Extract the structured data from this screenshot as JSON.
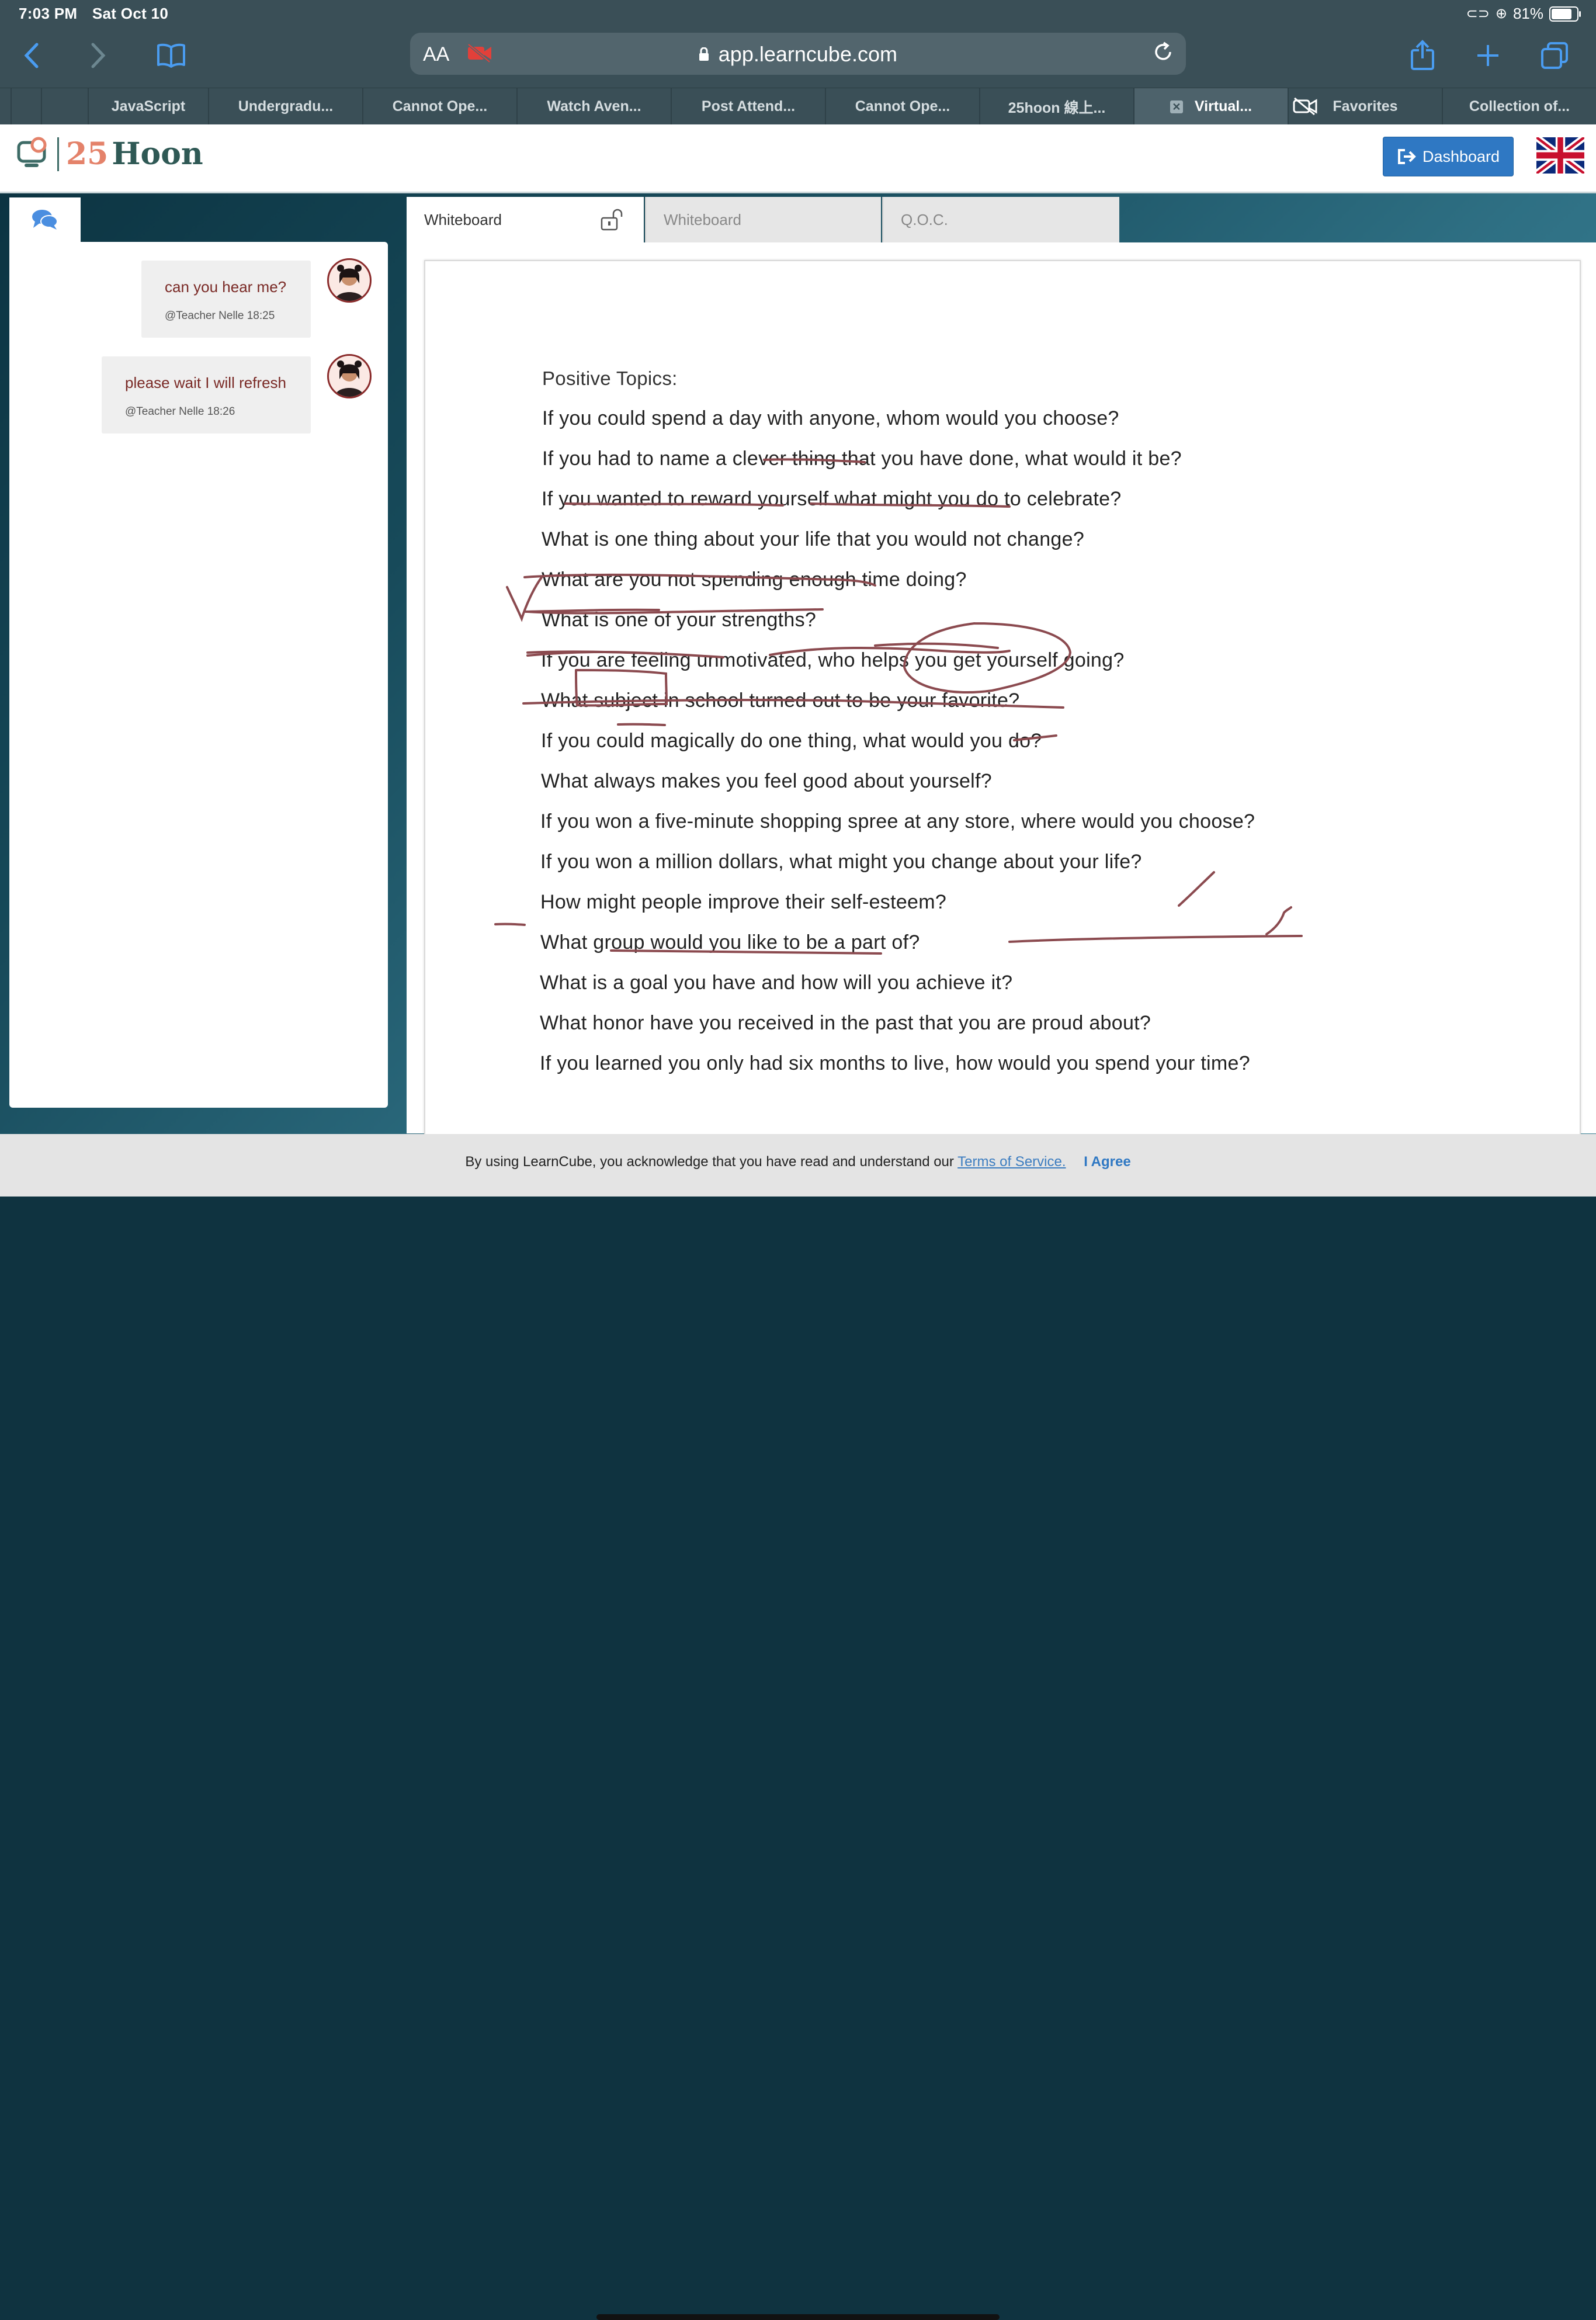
{
  "status_bar": {
    "time": "7:03 PM",
    "date": "Sat Oct 10",
    "battery": "81%",
    "battery_level": 0.81
  },
  "browser": {
    "aa_label": "AA",
    "url": "app.learncube.com",
    "icons": [
      "back-icon",
      "forward-icon",
      "bookmarks-icon",
      "camera-off-icon",
      "lock-icon",
      "reload-icon",
      "share-icon",
      "new-tab-icon",
      "tabs-icon"
    ],
    "tabs": [
      {
        "label": ""
      },
      {
        "label": ""
      },
      {
        "label": "JavaScript"
      },
      {
        "label": "Undergradu..."
      },
      {
        "label": "Cannot Ope..."
      },
      {
        "label": "Watch Aven..."
      },
      {
        "label": "Post Attend..."
      },
      {
        "label": "Cannot Ope..."
      },
      {
        "label": "25hoon 線上..."
      },
      {
        "label": "Virtual...",
        "active": true
      },
      {
        "label": "Favorites"
      },
      {
        "label": "Collection of..."
      }
    ]
  },
  "header": {
    "logo_number": "25",
    "logo_word": "Hoon",
    "dashboard_label": "Dashboard",
    "language_flag": "uk-flag-icon",
    "colors": {
      "primary": "#2f78c3",
      "logo_number": "#e4826a",
      "logo_word": "#2f5955"
    }
  },
  "chat": {
    "messages": [
      {
        "text": "can you hear me?",
        "meta": "@Teacher Nelle 18:25"
      },
      {
        "text": "please wait I will refresh",
        "meta": "@Teacher Nelle 18:26"
      }
    ]
  },
  "whiteboard_tabs": [
    {
      "label": "Whiteboard",
      "active": true
    },
    {
      "label": "Whiteboard",
      "active": false
    },
    {
      "label": "Q.O.C.",
      "active": false
    }
  ],
  "document": {
    "title": "Positive Topics:",
    "lines": [
      "If you could spend a day with anyone, whom would you choose?",
      "If you had to name a clever thing that you have done, what would it be?",
      "If you wanted to reward yourself what might you do to celebrate?",
      "What is one thing about your life that you would not change?",
      "What are you not spending enough time doing?",
      "What is one of your strengths?",
      "If you are feeling unmotivated, who helps you get yourself going?",
      "What subject in school turned out to be your favorite?",
      "If you could magically do one thing, what would you do?",
      "What always makes you feel good about yourself?",
      "If you won a five-minute shopping spree at any store, where would you choose?",
      "If you won a million dollars, what might you change about your life?",
      "How might people improve their self-esteem?",
      "What group would you like to be a part of?",
      "What is a goal you have and how will you achieve it?",
      "What honor have you received in the past that you are proud about?",
      "If you learned you only had six months to live, how would you spend your time?"
    ],
    "ink_color": "#8b4a4f"
  },
  "cookie_bar": {
    "text": "By using LearnCube, you acknowledge that you have read and understand our",
    "link": "Terms of Service.",
    "agree": "I Agree"
  }
}
